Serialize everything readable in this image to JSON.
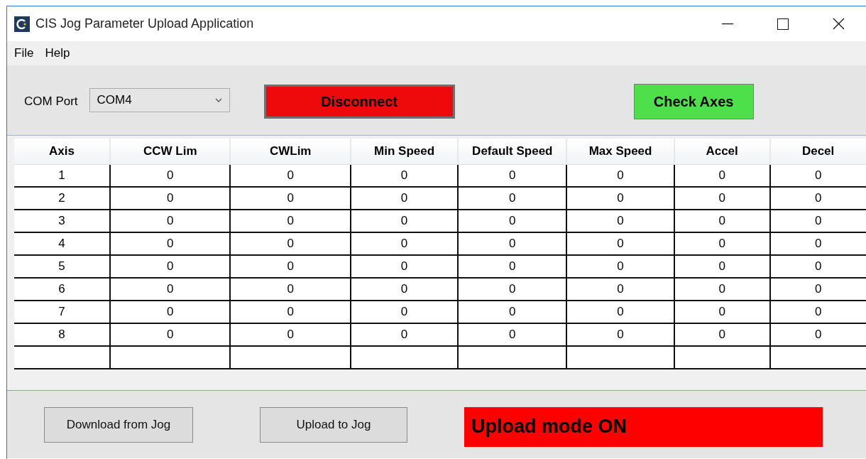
{
  "window": {
    "title": "CIS Jog Parameter Upload Application"
  },
  "menu": [
    "File",
    "Help"
  ],
  "connection": {
    "port_label": "COM Port",
    "port_value": "COM4",
    "connect_button": "Disconnect",
    "check_button": "Check Axes"
  },
  "table": {
    "columns": [
      "Axis",
      "CCW Lim",
      "CWLim",
      "Min Speed",
      "Default Speed",
      "Max Speed",
      "Accel",
      "Decel"
    ],
    "rows": [
      [
        "1",
        "0",
        "0",
        "0",
        "0",
        "0",
        "0",
        "0"
      ],
      [
        "2",
        "0",
        "0",
        "0",
        "0",
        "0",
        "0",
        "0"
      ],
      [
        "3",
        "0",
        "0",
        "0",
        "0",
        "0",
        "0",
        "0"
      ],
      [
        "4",
        "0",
        "0",
        "0",
        "0",
        "0",
        "0",
        "0"
      ],
      [
        "5",
        "0",
        "0",
        "0",
        "0",
        "0",
        "0",
        "0"
      ],
      [
        "6",
        "0",
        "0",
        "0",
        "0",
        "0",
        "0",
        "0"
      ],
      [
        "7",
        "0",
        "0",
        "0",
        "0",
        "0",
        "0",
        "0"
      ],
      [
        "8",
        "0",
        "0",
        "0",
        "0",
        "0",
        "0",
        "0"
      ]
    ]
  },
  "footer": {
    "buttons": [
      "Download from Jog",
      "Upload to Jog"
    ],
    "status": "Upload mode ON"
  }
}
